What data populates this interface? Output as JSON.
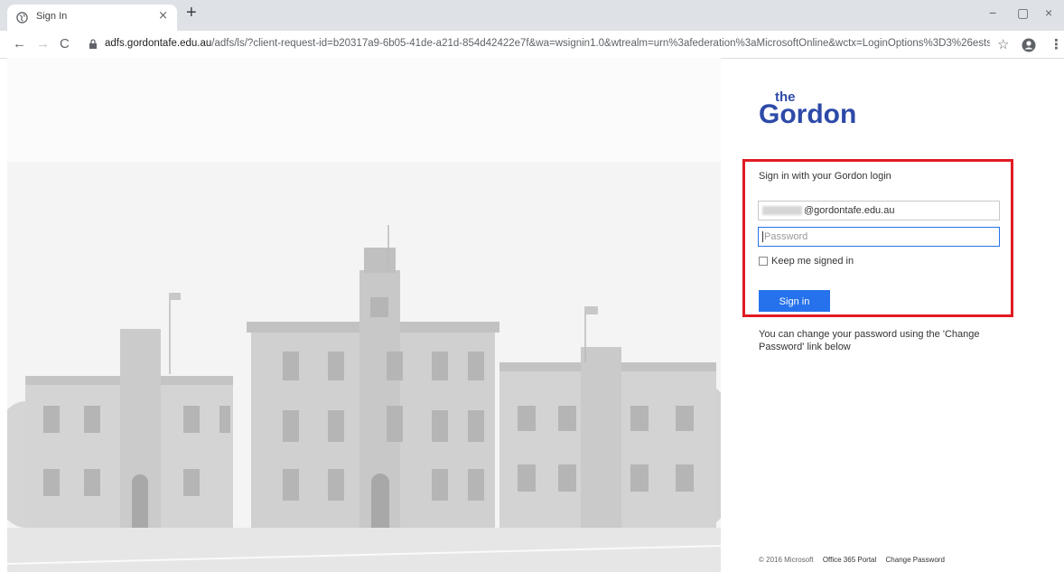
{
  "browser": {
    "tab_title": "Sign In",
    "tab_close": "×",
    "new_tab": "+",
    "url_domain": "adfs.gordontafe.edu.au",
    "url_rest": "/adfs/ls/?client-request-id=b20317a9-6b05-41de-a21d-854d42422e7f&wa=wsignin1.0&wtrealm=urn%3afederation%3aMicrosoftOnline&wctx=LoginOptions%3D3%26estsredirect%...",
    "win_min": "−",
    "win_max": "▢",
    "win_close": "×",
    "nav_back": "←",
    "nav_forward": "→",
    "nav_reload": "C",
    "star": "☆",
    "menu": "⋮"
  },
  "logo": {
    "text_top": "the",
    "text_main": "Gordon",
    "color": "#2d4aa8"
  },
  "login": {
    "heading": "Sign in with your Gordon login",
    "username_suffix": "@gordontafe.edu.au",
    "password_placeholder": "Password",
    "keep_signed_in": "Keep me signed in",
    "signin_button": "Sign in",
    "highlight_color": "#e11b22",
    "button_color": "#2672ec"
  },
  "info_text": "You can change your password using the 'Change Password' link below",
  "footer": {
    "copyright": "© 2016 Microsoft",
    "office_portal": "Office 365 Portal",
    "change_password": "Change Password"
  },
  "icons": [
    "globe-icon",
    "lock-icon",
    "star-icon",
    "profile-icon",
    "menu-icon"
  ]
}
